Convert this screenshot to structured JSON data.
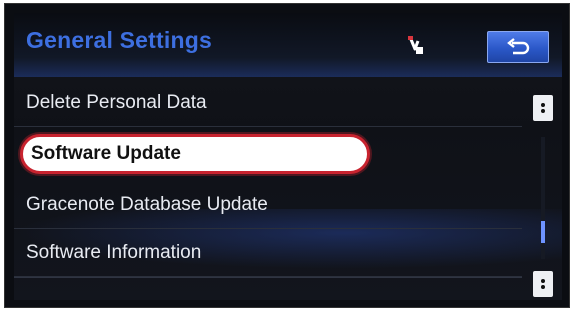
{
  "header": {
    "title": "General Settings",
    "back_icon": "back-arrow-icon",
    "flag_icon": "voice-command-icon"
  },
  "menu": {
    "items": [
      {
        "label": "Delete Personal Data",
        "highlighted": false
      },
      {
        "label": "Software Update",
        "highlighted": true
      },
      {
        "label": "Gracenote Database Update",
        "highlighted": false
      },
      {
        "label": "Software Information",
        "highlighted": false
      }
    ]
  },
  "scroll": {
    "up_icon": "scroll-up-icon",
    "down_icon": "scroll-down-icon"
  },
  "colors": {
    "title": "#3d6fe0",
    "highlight_border": "#c8232f",
    "back_button": "#2b58c8"
  }
}
